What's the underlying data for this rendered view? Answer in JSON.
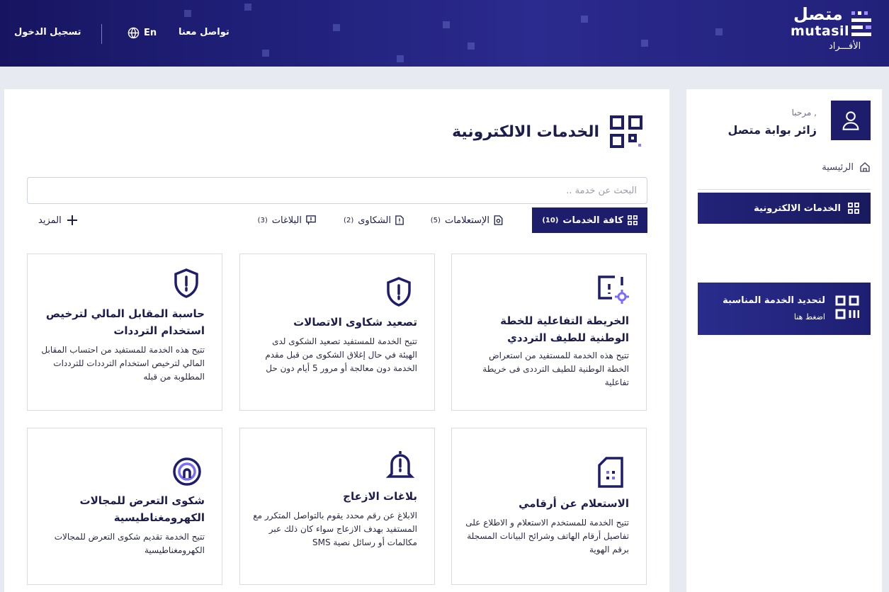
{
  "header": {
    "login": "تسجيل الدخول",
    "language": "En",
    "contact": "تواصل معنا",
    "logo_ar": "متصل",
    "logo_en": "mutasil",
    "logo_sub": "الأفـــراد"
  },
  "sidebar": {
    "greeting": "مرحبا ,",
    "visitor": "زائر بوابة متصل",
    "home": "الرئيسية",
    "active_item": "الخدمات الالكترونية",
    "promo_title": "لتحديد الخدمة المناسبة",
    "promo_sub": "اضغط هنا"
  },
  "main": {
    "title": "الخدمات الالكترونية",
    "search_placeholder": "البحث عن خدمة ..",
    "tabs": [
      {
        "label": "كافة الخدمات",
        "count": "(10)"
      },
      {
        "label": "الإستعلامات",
        "count": "(5)"
      },
      {
        "label": "الشكاوى",
        "count": "(2)"
      },
      {
        "label": "البلاغات",
        "count": "(3)"
      }
    ],
    "more": "المزيد",
    "cards": [
      {
        "title": "الخريطة التفاعلية للخطة الوطنية للطيف الترددي",
        "desc": "تتيح هذه الخدمة للمستفيد من استعراض الخطة الوطنية للطيف الترددى فى خريطة تفاعلية",
        "icon": "map-gear-icon"
      },
      {
        "title": "تصعيد شكاوى الاتصالات",
        "desc": "تتيح الخدمة للمستفيد تصعيد الشكوى لدى الهيئة في حال إغلاق الشكوى من قبل مقدم الخدمة دون معالجة أو مرور 5 أيام دون حل",
        "icon": "shield-alert-icon"
      },
      {
        "title": "حاسبة المقابل المالي لترخيص استخدام الترددات",
        "desc": "تتيح هذه الخدمة للمستفيد من احتساب المقابل المالي لترخيص استخدام الترددات للترددات المطلوبة من قبله",
        "icon": "shield-alert-icon"
      },
      {
        "title": "الاستعلام عن أرقامي",
        "desc": "تتيح الخدمة للمستخدم الاستعلام و الاطلاع على تفاصيل أرقام الهاتف وشرائح البيانات المسجلة برقم الهوية",
        "icon": "sim-card-icon"
      },
      {
        "title": "بلاغات الازعاج",
        "desc": "الابلاغ عن رقم محدد يقوم بالتواصل المتكرر مع المستفيد بهدف الازعاج سواء كان ذلك عبر مكالمات أو رسائل نصية SMS",
        "icon": "bell-alert-icon"
      },
      {
        "title": "شكوى التعرض للمجالات الكهرومغناطيسية",
        "desc": "تتيح الخدمة تقديم شكوى التعرض للمجالات الكهرومغناطيسية",
        "icon": "signal-radar-icon"
      }
    ]
  }
}
